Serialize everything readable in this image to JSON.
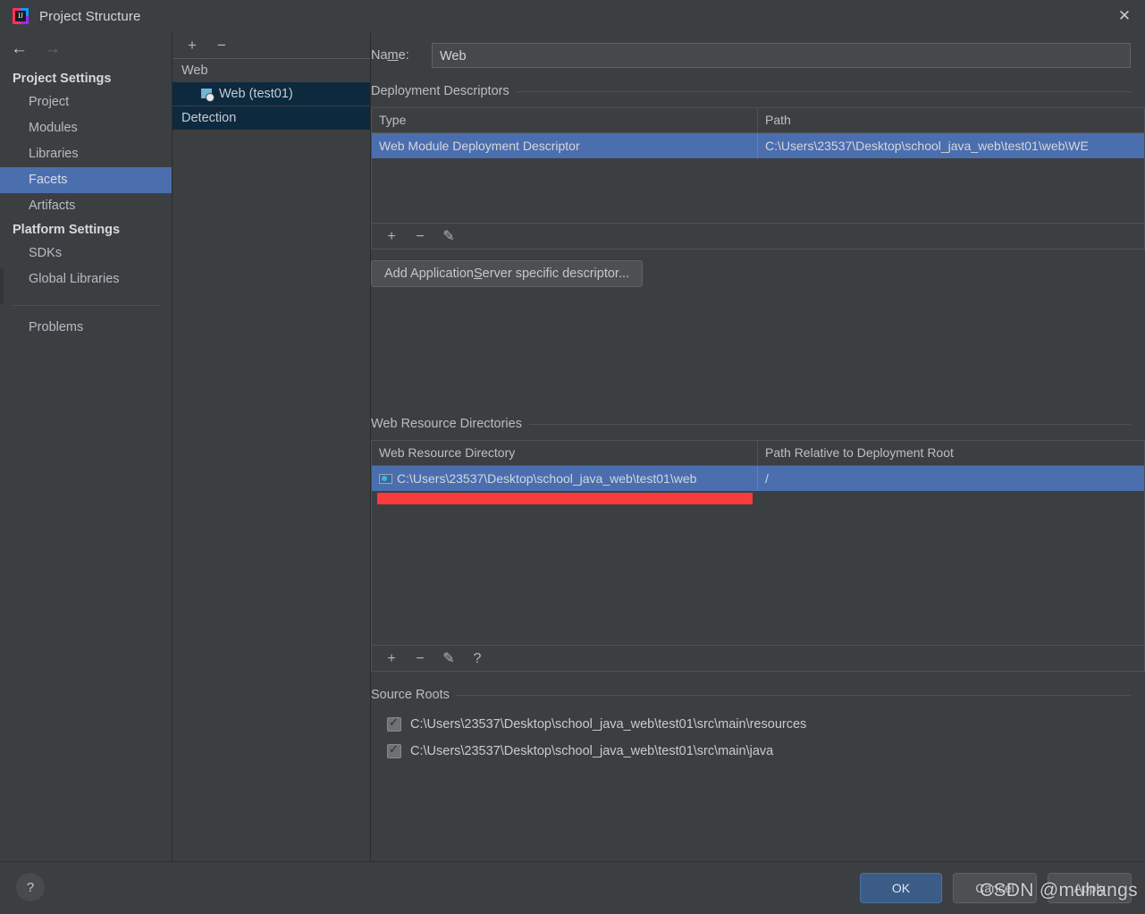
{
  "window": {
    "title": "Project Structure",
    "app_icon": "intellij-idea-icon",
    "close_icon": "close-icon"
  },
  "nav": {
    "back_icon": "arrow-left-icon",
    "forward_icon": "arrow-right-icon"
  },
  "sidebar": {
    "groups": [
      {
        "label": "Project Settings",
        "items": [
          "Project",
          "Modules",
          "Libraries",
          "Facets",
          "Artifacts"
        ]
      },
      {
        "label": "Platform Settings",
        "items": [
          "SDKs",
          "Global Libraries"
        ]
      }
    ],
    "selected": "Facets",
    "extra_items": [
      "Problems"
    ]
  },
  "midpanel": {
    "toolbar": {
      "add": "+",
      "remove": "−"
    },
    "group_label": "Web",
    "selected_item": "Web (test01)",
    "selected_item_icon": "web-facet-icon",
    "detection_label": "Detection"
  },
  "main": {
    "name": {
      "label_prefix": "Na",
      "label_mnemonic": "m",
      "label_suffix": "e:",
      "value": "Web"
    },
    "deployment_descriptors": {
      "title": "Deployment Descriptors",
      "columns": [
        "Type",
        "Path"
      ],
      "rows": [
        {
          "type": "Web Module Deployment Descriptor",
          "path": "C:\\Users\\23537\\Desktop\\school_java_web\\test01\\web\\WE",
          "selected": true
        }
      ],
      "toolbar": {
        "add": "+",
        "remove": "−",
        "edit": "✎"
      },
      "add_server_button": {
        "prefix": "Add Application ",
        "mnemonic": "S",
        "suffix": "erver specific descriptor..."
      }
    },
    "web_resource_directories": {
      "title": "Web Resource Directories",
      "columns": [
        "Web Resource Directory",
        "Path Relative to Deployment Root"
      ],
      "rows": [
        {
          "directory": "C:\\Users\\23537\\Desktop\\school_java_web\\test01\\web",
          "relative_path": "/",
          "icon": "folder-icon",
          "selected": true
        }
      ],
      "annotation_color": "#f93b3b",
      "toolbar": {
        "add": "+",
        "remove": "−",
        "edit": "✎",
        "help": "?"
      }
    },
    "source_roots": {
      "title": "Source Roots",
      "items": [
        {
          "path": "C:\\Users\\23537\\Desktop\\school_java_web\\test01\\src\\main\\resources",
          "checked": true
        },
        {
          "path": "C:\\Users\\23537\\Desktop\\school_java_web\\test01\\src\\main\\java",
          "checked": true
        }
      ]
    }
  },
  "footer": {
    "help_icon": "?",
    "ok": "OK",
    "cancel": "Cancel",
    "apply": "Apply"
  },
  "watermark": {
    "text": "CSDN @muhangs"
  },
  "colors": {
    "selection_blue": "#4b6eaf",
    "tree_selection": "#0d293e",
    "background": "#3c3f41",
    "annotation_red": "#f93b3b",
    "primary_button": "#3b5c86"
  }
}
